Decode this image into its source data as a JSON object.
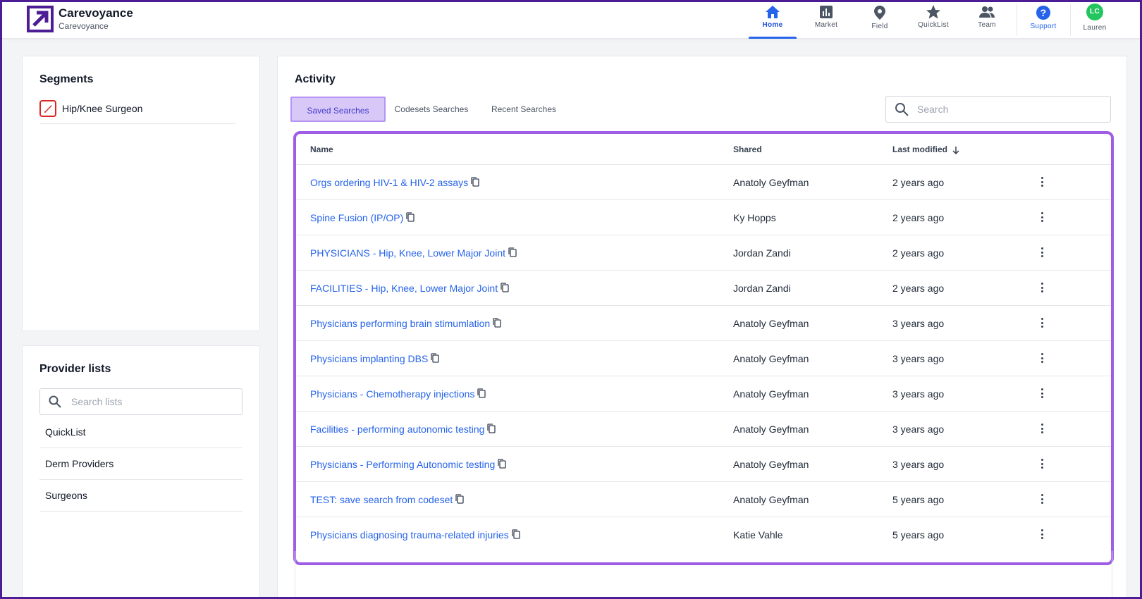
{
  "app": {
    "brand_title": "Carevoyance",
    "brand_subtitle": "Carevoyance",
    "accent_color": "#2563eb",
    "logo_color": "#4c1d95"
  },
  "nav": {
    "items": [
      {
        "label": "Home",
        "icon": "home-icon",
        "active": true
      },
      {
        "label": "Market",
        "icon": "bar-chart-icon",
        "active": false
      },
      {
        "label": "Field",
        "icon": "map-pin-icon",
        "active": false
      },
      {
        "label": "QuickList",
        "icon": "star-icon",
        "active": false
      },
      {
        "label": "Team",
        "icon": "team-icon",
        "active": false
      },
      {
        "label": "Support",
        "icon": "help-icon",
        "active": false
      },
      {
        "label": "Lauren",
        "icon": "avatar",
        "active": false
      }
    ],
    "avatar_initials": "LC"
  },
  "segments": {
    "title": "Segments",
    "items": [
      {
        "label": "Hip/Knee Surgeon",
        "icon": "scalpel-icon"
      }
    ]
  },
  "provider_lists": {
    "title": "Provider lists",
    "search_placeholder": "Search lists",
    "items": [
      "QuickList",
      "Derm Providers",
      "Surgeons"
    ]
  },
  "activity": {
    "title": "Activity",
    "tabs": [
      "Saved Searches",
      "Codesets Searches",
      "Recent Searches"
    ],
    "active_tab": "Saved Searches",
    "search_placeholder": "Search",
    "columns": {
      "name": "Name",
      "shared": "Shared",
      "last_modified": "Last modified"
    },
    "rows": [
      {
        "name": "Orgs ordering HIV-1 & HIV-2 assays",
        "shared": "Anatoly Geyfman",
        "modified": "2 years ago"
      },
      {
        "name": "Spine Fusion (IP/OP)",
        "shared": "Ky Hopps",
        "modified": "2 years ago"
      },
      {
        "name": "PHYSICIANS - Hip, Knee, Lower Major Joint",
        "shared": "Jordan Zandi",
        "modified": "2 years ago"
      },
      {
        "name": "FACILITIES - Hip, Knee, Lower Major Joint",
        "shared": "Jordan Zandi",
        "modified": "2 years ago"
      },
      {
        "name": "Physicians performing brain stimumlation",
        "shared": "Anatoly Geyfman",
        "modified": "3 years ago"
      },
      {
        "name": "Physicians implanting DBS",
        "shared": "Anatoly Geyfman",
        "modified": "3 years ago"
      },
      {
        "name": "Physicians - Chemotherapy injections",
        "shared": "Anatoly Geyfman",
        "modified": "3 years ago"
      },
      {
        "name": "Facilities - performing autonomic testing",
        "shared": "Anatoly Geyfman",
        "modified": "3 years ago"
      },
      {
        "name": "Physicians - Performing Autonomic testing",
        "shared": "Anatoly Geyfman",
        "modified": "3 years ago"
      },
      {
        "name": "TEST: save search from codeset",
        "shared": "Anatoly Geyfman",
        "modified": "5 years ago"
      },
      {
        "name": "Physicians diagnosing trauma-related injuries",
        "shared": "Katie Vahle",
        "modified": "5 years ago"
      }
    ]
  }
}
